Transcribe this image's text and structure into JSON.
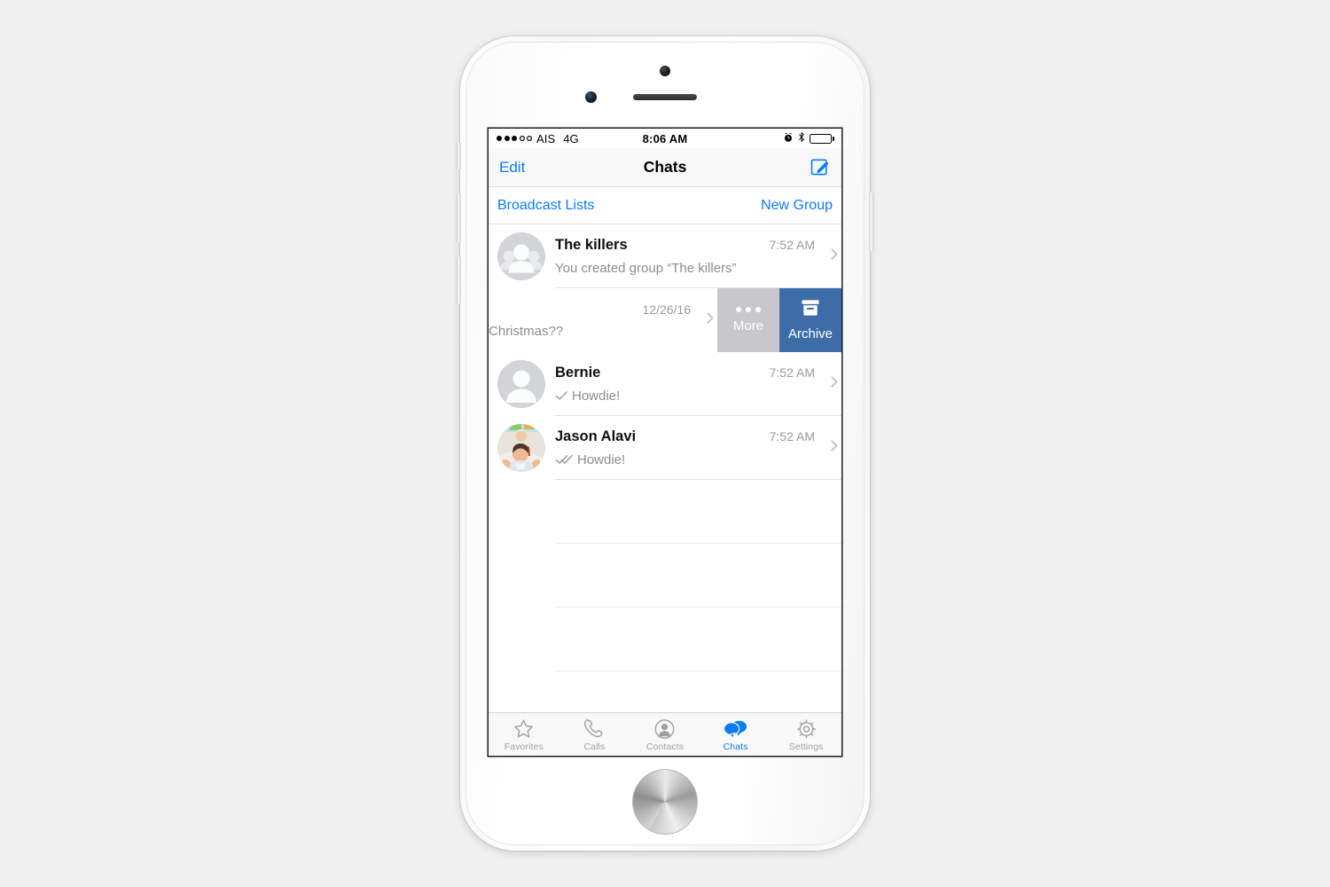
{
  "device": {
    "type": "smartphone-white"
  },
  "status_bar": {
    "signal_dots_filled": 3,
    "signal_dots_total": 5,
    "carrier": "AIS",
    "network": "4G",
    "time": "8:06 AM",
    "icons": [
      "alarm-icon",
      "bluetooth-icon",
      "battery-icon"
    ],
    "battery_level": 100
  },
  "nav_bar": {
    "left_button": "Edit",
    "title": "Chats",
    "right_icon": "compose-icon"
  },
  "broadcast_bar": {
    "left_label": "Broadcast Lists",
    "right_label": "New Group"
  },
  "chats": [
    {
      "avatar": "group-avatar",
      "name": "The killers",
      "time": "7:52 AM",
      "message": "You created group “The killers”",
      "ticks": "none"
    },
    {
      "avatar": "person-avatar",
      "name": "",
      "time": "12/26/16",
      "message": "How was Christmas??",
      "ticks": "none",
      "swiped": true,
      "actions": [
        {
          "label": "More",
          "icon": "ellipsis-icon",
          "color": "#c8c7cc"
        },
        {
          "label": "Archive",
          "icon": "archive-box-icon",
          "color": "#3d6da9"
        }
      ]
    },
    {
      "avatar": "person-avatar",
      "name": "Bernie",
      "time": "7:52 AM",
      "message": "Howdie!",
      "ticks": "single"
    },
    {
      "avatar": "photo-avatar",
      "name": "Jason Alavi",
      "time": "7:52 AM",
      "message": "Howdie!",
      "ticks": "double"
    }
  ],
  "empty_rows": 4,
  "tab_bar": {
    "items": [
      {
        "label": "Favorites",
        "icon": "star-icon",
        "active": false
      },
      {
        "label": "Calls",
        "icon": "phone-icon",
        "active": false
      },
      {
        "label": "Contacts",
        "icon": "contact-circle-icon",
        "active": false
      },
      {
        "label": "Chats",
        "icon": "chat-bubbles-icon",
        "active": true
      },
      {
        "label": "Settings",
        "icon": "gear-icon",
        "active": false
      }
    ]
  },
  "colors": {
    "accent": "#0b7cfb",
    "archive": "#3d6da9",
    "more": "#c8c7cc",
    "page_background": "#f0f0f0"
  }
}
